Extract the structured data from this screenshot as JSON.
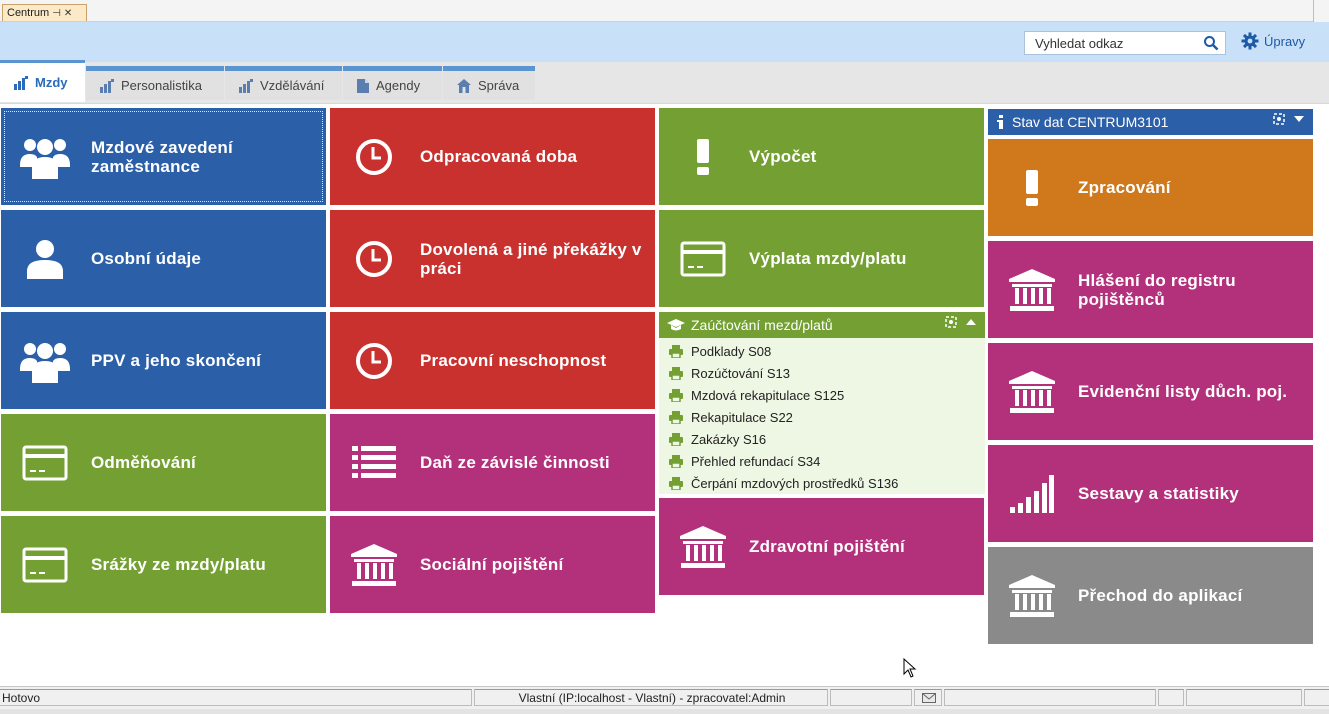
{
  "window_tab": {
    "title": "Centrum"
  },
  "header": {
    "search_placeholder": "Vyhledat odkaz",
    "settings_label": "Úpravy"
  },
  "tabs": [
    {
      "label": "Mzdy",
      "active": true
    },
    {
      "label": "Personalistika",
      "active": false
    },
    {
      "label": "Vzdělávání",
      "active": false
    },
    {
      "label": "Agendy",
      "active": false
    },
    {
      "label": "Správa",
      "active": false
    }
  ],
  "tiles": {
    "mzdove_zavedeni": "Mzdové zavedení zaměstnance",
    "osobni_udaje": "Osobní údaje",
    "ppv": "PPV a jeho skončení",
    "odmenovani": "Odměňování",
    "srazky": "Srážky ze mzdy/platu",
    "odpracovana_doba": "Odpracovaná doba",
    "dovolena": "Dovolená a jiné překážky v práci",
    "pracovni_neschopnost": "Pracovní neschopnost",
    "dan": "Daň ze závislé činnosti",
    "socialni": "Sociální pojištění",
    "vypocet": "Výpočet",
    "vyplata": "Výplata mzdy/platu",
    "zdravotni": "Zdravotní pojištění",
    "zpracovani": "Zpracování",
    "hlaseni": "Hlášení do registru pojištěnců",
    "evidencni": "Evidenční listy důch. poj.",
    "sestavy": "Sestavy a statistiky",
    "prechod": "Přechod do aplikací"
  },
  "zauctovani": {
    "title": "Zaúčtování mezd/platů",
    "items": [
      "Podklady S08",
      "Rozúčtování S13",
      "Mzdová rekapitulace S125",
      "Rekapitulace S22",
      "Zakázky S16",
      "Přehled refundací S34",
      "Čerpání mzdových prostředků S136"
    ]
  },
  "stav_dat": {
    "title": "Stav dat CENTRUM3101"
  },
  "colors": {
    "blue": "#2b5fa8",
    "red": "#c9312e",
    "green": "#74a033",
    "magenta": "#b3317b",
    "orange": "#cf781c",
    "gray": "#8a8a8a",
    "header": "#c9e1f8"
  },
  "statusbar": {
    "status": "Hotovo",
    "connection": "Vlastní (IP:localhost - Vlastní) - zpracovatel:Admin"
  }
}
